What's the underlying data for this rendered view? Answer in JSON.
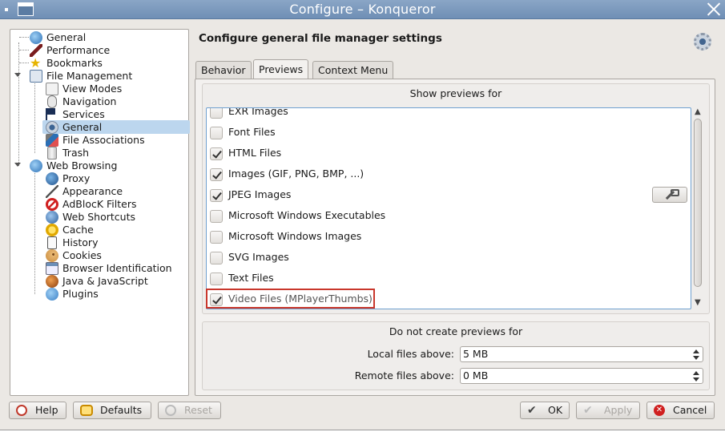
{
  "window": {
    "title": "Configure – Konqueror"
  },
  "tree": {
    "items": [
      {
        "label": "General",
        "icon": "globe-icon",
        "level": 0
      },
      {
        "label": "Performance",
        "icon": "rocket-icon",
        "level": 0
      },
      {
        "label": "Bookmarks",
        "icon": "star-icon",
        "level": 0
      },
      {
        "label": "File Management",
        "icon": "file-manager-icon",
        "level": 0,
        "expanded": true
      },
      {
        "label": "View Modes",
        "icon": "view-modes-icon",
        "level": 1
      },
      {
        "label": "Navigation",
        "icon": "mouse-icon",
        "level": 1
      },
      {
        "label": "Services",
        "icon": "flag-icon",
        "level": 1
      },
      {
        "label": "General",
        "icon": "gear-icon",
        "level": 1,
        "selected": true
      },
      {
        "label": "File Associations",
        "icon": "file-associations-icon",
        "level": 1
      },
      {
        "label": "Trash",
        "icon": "trash-icon",
        "level": 1
      },
      {
        "label": "Web Browsing",
        "icon": "globe-icon",
        "level": 0,
        "expanded": true
      },
      {
        "label": "Proxy",
        "icon": "proxy-globe-icon",
        "level": 1
      },
      {
        "label": "Appearance",
        "icon": "appearance-icon",
        "level": 1
      },
      {
        "label": "AdBlocK Filters",
        "icon": "no-entry-icon",
        "level": 1
      },
      {
        "label": "Web Shortcuts",
        "icon": "web-shortcuts-icon",
        "level": 1
      },
      {
        "label": "Cache",
        "icon": "cache-icon",
        "level": 1
      },
      {
        "label": "History",
        "icon": "history-icon",
        "level": 1
      },
      {
        "label": "Cookies",
        "icon": "cookie-icon",
        "level": 1
      },
      {
        "label": "Browser Identification",
        "icon": "browser-id-icon",
        "level": 1
      },
      {
        "label": "Java & JavaScript",
        "icon": "java-icon",
        "level": 1
      },
      {
        "label": "Plugins",
        "icon": "plugins-icon",
        "level": 1
      }
    ]
  },
  "header": {
    "title": "Configure general file manager settings"
  },
  "tabs": [
    {
      "label": "Behavior",
      "active": false
    },
    {
      "label": "Previews",
      "active": true
    },
    {
      "label": "Context Menu",
      "active": false
    }
  ],
  "previews": {
    "show_title": "Show previews for",
    "items": [
      {
        "label": "EXR Images",
        "checked": false
      },
      {
        "label": "Font Files",
        "checked": false
      },
      {
        "label": "HTML Files",
        "checked": true
      },
      {
        "label": "Images (GIF, PNG, BMP, ...)",
        "checked": true
      },
      {
        "label": "JPEG Images",
        "checked": true,
        "configurable": true
      },
      {
        "label": "Microsoft Windows Executables",
        "checked": false
      },
      {
        "label": "Microsoft Windows Images",
        "checked": false
      },
      {
        "label": "SVG Images",
        "checked": false
      },
      {
        "label": "Text Files",
        "checked": false
      },
      {
        "label": "Video Files (MPlayerThumbs)",
        "checked": true,
        "highlighted": true
      }
    ],
    "no_preview_title": "Do not create previews for",
    "local_label": "Local files above:",
    "local_value": "5 MB",
    "remote_label": "Remote files above:",
    "remote_value": "0 MB"
  },
  "buttons": {
    "help": "Help",
    "defaults": "Defaults",
    "reset": "Reset",
    "ok": "OK",
    "apply": "Apply",
    "cancel": "Cancel"
  },
  "colors": {
    "titlebar": "#7494bb",
    "selection": "#bcd6ee",
    "highlight_box": "#c9372c",
    "focus_border": "#6fa0d0"
  }
}
